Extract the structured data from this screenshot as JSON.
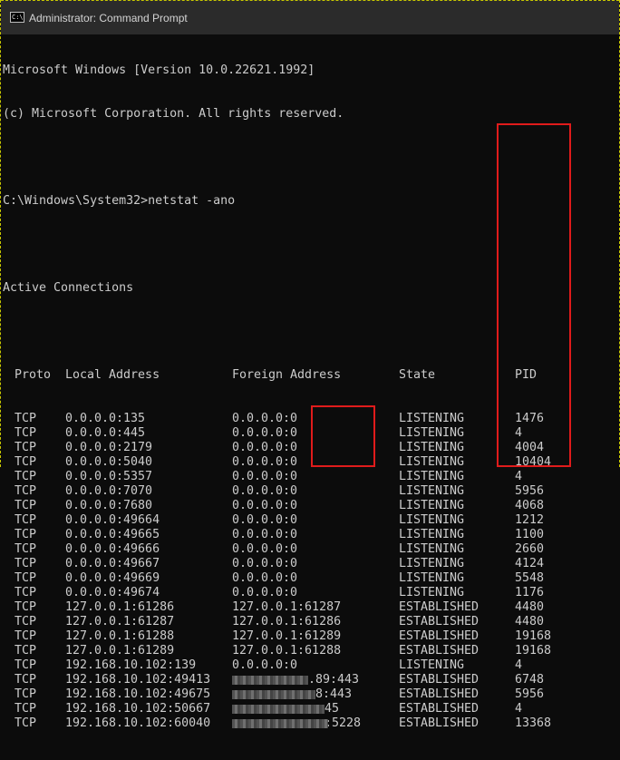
{
  "window": {
    "title": "Administrator: Command Prompt",
    "icon": "cmd-icon"
  },
  "console": {
    "banner_line1": "Microsoft Windows [Version 10.0.22621.1992]",
    "banner_line2": "(c) Microsoft Corporation. All rights reserved.",
    "prompt": "C:\\Windows\\System32>netstat -ano",
    "section_title": "Active Connections",
    "headers": {
      "proto": "Proto",
      "local": "Local Address",
      "foreign": "Foreign Address",
      "state": "State",
      "pid": "PID"
    },
    "rows": [
      {
        "proto": "TCP",
        "local": "0.0.0.0:135",
        "foreign": "0.0.0.0:0",
        "state": "LISTENING",
        "pid": "1476"
      },
      {
        "proto": "TCP",
        "local": "0.0.0.0:445",
        "foreign": "0.0.0.0:0",
        "state": "LISTENING",
        "pid": "4"
      },
      {
        "proto": "TCP",
        "local": "0.0.0.0:2179",
        "foreign": "0.0.0.0:0",
        "state": "LISTENING",
        "pid": "4004"
      },
      {
        "proto": "TCP",
        "local": "0.0.0.0:5040",
        "foreign": "0.0.0.0:0",
        "state": "LISTENING",
        "pid": "10404"
      },
      {
        "proto": "TCP",
        "local": "0.0.0.0:5357",
        "foreign": "0.0.0.0:0",
        "state": "LISTENING",
        "pid": "4"
      },
      {
        "proto": "TCP",
        "local": "0.0.0.0:7070",
        "foreign": "0.0.0.0:0",
        "state": "LISTENING",
        "pid": "5956"
      },
      {
        "proto": "TCP",
        "local": "0.0.0.0:7680",
        "foreign": "0.0.0.0:0",
        "state": "LISTENING",
        "pid": "4068"
      },
      {
        "proto": "TCP",
        "local": "0.0.0.0:49664",
        "foreign": "0.0.0.0:0",
        "state": "LISTENING",
        "pid": "1212"
      },
      {
        "proto": "TCP",
        "local": "0.0.0.0:49665",
        "foreign": "0.0.0.0:0",
        "state": "LISTENING",
        "pid": "1100"
      },
      {
        "proto": "TCP",
        "local": "0.0.0.0:49666",
        "foreign": "0.0.0.0:0",
        "state": "LISTENING",
        "pid": "2660"
      },
      {
        "proto": "TCP",
        "local": "0.0.0.0:49667",
        "foreign": "0.0.0.0:0",
        "state": "LISTENING",
        "pid": "4124"
      },
      {
        "proto": "TCP",
        "local": "0.0.0.0:49669",
        "foreign": "0.0.0.0:0",
        "state": "LISTENING",
        "pid": "5548"
      },
      {
        "proto": "TCP",
        "local": "0.0.0.0:49674",
        "foreign": "0.0.0.0:0",
        "state": "LISTENING",
        "pid": "1176"
      },
      {
        "proto": "TCP",
        "local": "127.0.0.1:61286",
        "foreign": "127.0.0.1:61287",
        "state": "ESTABLISHED",
        "pid": "4480"
      },
      {
        "proto": "TCP",
        "local": "127.0.0.1:61287",
        "foreign": "127.0.0.1:61286",
        "state": "ESTABLISHED",
        "pid": "4480"
      },
      {
        "proto": "TCP",
        "local": "127.0.0.1:61288",
        "foreign": "127.0.0.1:61289",
        "state": "ESTABLISHED",
        "pid": "19168"
      },
      {
        "proto": "TCP",
        "local": "127.0.0.1:61289",
        "foreign": "127.0.0.1:61288",
        "state": "ESTABLISHED",
        "pid": "19168"
      },
      {
        "proto": "TCP",
        "local": "192.168.10.102:139",
        "foreign": "0.0.0.0:0",
        "state": "LISTENING",
        "pid": "4"
      },
      {
        "proto": "TCP",
        "local": "192.168.10.102:49413",
        "foreign": ".89:443",
        "state": "ESTABLISHED",
        "pid": "6748"
      },
      {
        "proto": "TCP",
        "local": "192.168.10.102:49675",
        "foreign": "8:443",
        "state": "ESTABLISHED",
        "pid": "5956"
      },
      {
        "proto": "TCP",
        "local": "192.168.10.102:50667",
        "foreign": "45",
        "state": "ESTABLISHED",
        "pid": "4"
      },
      {
        "proto": "TCP",
        "local": "192.168.10.102:60040",
        "foreign": ":5228",
        "state": "ESTABLISHED",
        "pid": "13368"
      }
    ]
  },
  "colors": {
    "console_bg": "#0c0c0c",
    "console_text": "#cccccc",
    "titlebar_bg": "#2b2b2b",
    "highlight": "#e01b1b"
  }
}
